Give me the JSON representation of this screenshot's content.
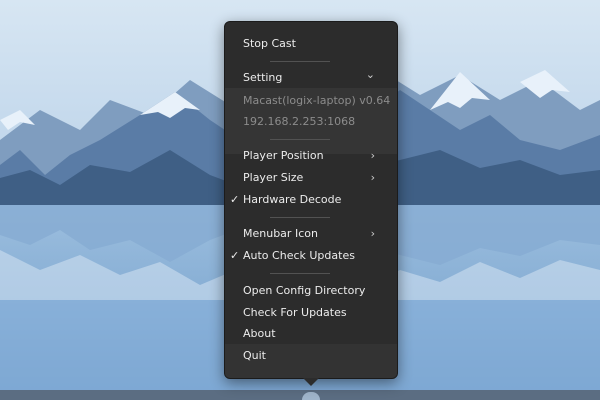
{
  "menu": {
    "stop_cast": "Stop Cast",
    "setting": "Setting",
    "app_version": "Macast(logix-laptop) v0.64",
    "address": "192.168.2.253:1068",
    "player_position": "Player Position",
    "player_size": "Player Size",
    "hardware_decode": "Hardware Decode",
    "menubar_icon": "Menubar Icon",
    "auto_check_updates": "Auto Check Updates",
    "open_config_directory": "Open Config Directory",
    "check_for_updates": "Check For Updates",
    "about": "About",
    "quit": "Quit",
    "check_mark": "✓",
    "chevron_right": "›",
    "chevron_down": "⌄"
  },
  "colors": {
    "menu_bg": "#2c2c2c",
    "menu_text": "#ececec",
    "info_text": "#8c8c8c",
    "separator": "#525252",
    "sky": "#a9c8e6",
    "mountain_dark": "#3f5f85",
    "lake": "#6f9cc9"
  },
  "icons": {
    "setting_toggle": "chevron-down-icon",
    "submenu": "chevron-right-icon",
    "checked": "check-icon"
  }
}
